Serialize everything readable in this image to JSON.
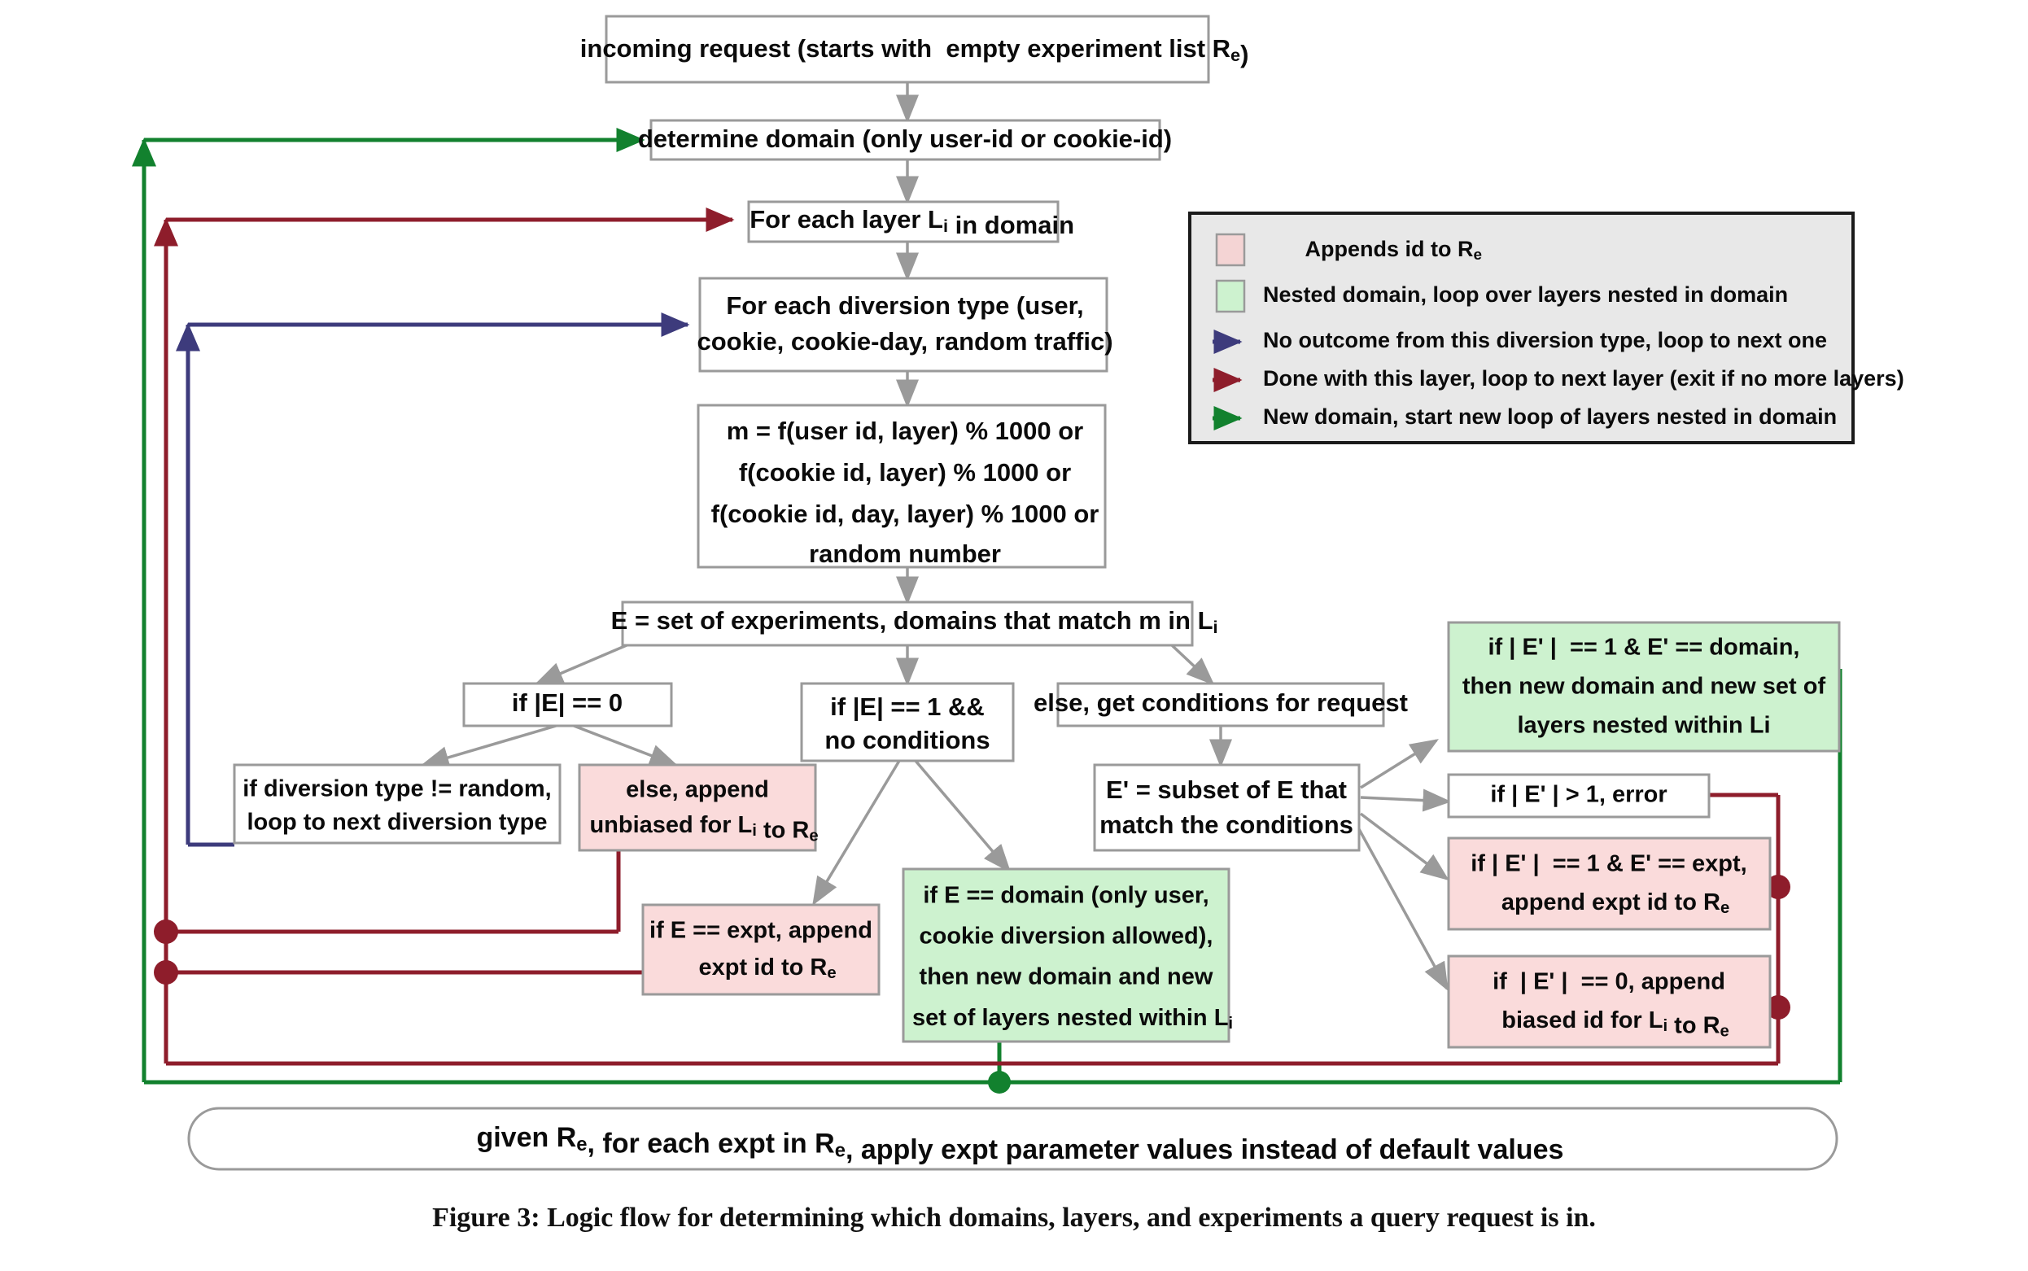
{
  "figure": {
    "caption": "Figure 3: Logic flow for determining which domains, layers, and experiments a query request is in."
  },
  "nodes": {
    "incoming_request": "incoming request (starts with  empty experiment list Re)",
    "incoming_request_l1": "incoming request (starts with  empty experiment list R",
    "incoming_request_sub": "e",
    "incoming_request_l1b": ")",
    "determine_domain": "determine domain (only user-id or cookie-id)",
    "for_each_layer_a": "For each layer L",
    "for_each_layer_sub": "i",
    "for_each_layer_b": " in domain",
    "diversion_type_l1": "For each diversion type (user,",
    "diversion_type_l2": "cookie, cookie-day, random traffic)",
    "formula_l1": "m = f(user id, layer) % 1000 or",
    "formula_l2": "f(cookie id, layer) % 1000 or",
    "formula_l3": "f(cookie id, day, layer) % 1000 or",
    "formula_l4": "random number",
    "e_set_a": "E = set of experiments, domains that match m in L",
    "e_set_sub": "i",
    "if_e_zero": "if |E| == 0",
    "if_e_one_l1": "if |E| == 1 &&",
    "if_e_one_l2": "no conditions",
    "else_conditions": "else, get conditions for request",
    "diversion_not_random_l1": "if diversion type != random,",
    "diversion_not_random_l2": "loop to next diversion type",
    "append_unbiased_l1": "else, append",
    "append_unbiased_l2a": "unbiased for L",
    "append_unbiased_sub1": "i",
    "append_unbiased_l2b": " to R",
    "append_unbiased_sub2": "e",
    "e_expt_l1": "if E == expt, append",
    "e_expt_l2a": "expt id to R",
    "e_expt_sub": "e",
    "e_domain_l1": "if E == domain (only user,",
    "e_domain_l2": "cookie diversion allowed),",
    "e_domain_l3": "then new domain and new",
    "e_domain_l4a": "set of layers nested within L",
    "e_domain_sub": "i",
    "eprime_subset_l1": "E' = subset of E that",
    "eprime_subset_l2": "match the conditions",
    "eprime_domain_l1": "if | E' |  == 1 & E' == domain,",
    "eprime_domain_l2": "then new domain and new set of",
    "eprime_domain_l3": "layers nested within Li",
    "eprime_error": "if | E' | > 1, error",
    "eprime_expt_l1": "if | E' |  == 1 & E' == expt,",
    "eprime_expt_l2a": "append expt id to R",
    "eprime_expt_sub": "e",
    "eprime_zero_l1": "if  | E' |  == 0, append",
    "eprime_zero_l2a": "biased id for L",
    "eprime_zero_sub1": "i",
    "eprime_zero_l2b": " to R",
    "eprime_zero_sub2": "e",
    "final_a": "given R",
    "final_sub1": "e",
    "final_b": ", for each expt in R",
    "final_sub2": "e",
    "final_c": ", apply expt parameter values instead of default values"
  },
  "legend": {
    "items": [
      {
        "kind": "swatch",
        "color": "#f4d4d4",
        "label_a": "Appends id to R",
        "label_sub": "e",
        "label_b": ""
      },
      {
        "kind": "swatch",
        "color": "#cdf2cf",
        "label_a": "Nested domain, loop over layers nested in domain",
        "label_sub": "",
        "label_b": ""
      },
      {
        "kind": "arrow",
        "color": "#3d3b7c",
        "label_a": "No outcome from this diversion type, loop to next one",
        "label_sub": "",
        "label_b": ""
      },
      {
        "kind": "arrow",
        "color": "#8e1d2b",
        "label_a": "Done with this layer, loop to next layer (exit if no more layers)",
        "label_sub": "",
        "label_b": ""
      },
      {
        "kind": "arrow",
        "color": "#12812e",
        "label_a": "New domain, start new loop of layers nested in domain",
        "label_sub": "",
        "label_b": ""
      }
    ]
  },
  "colors": {
    "pink_fill": "#fadbdb",
    "green_fill": "#cdf2cf",
    "box_stroke": "#9a9a9a",
    "red_line": "#8e1d2b",
    "green_line": "#12812e",
    "blue_line": "#3d3b7c",
    "legend_fill": "#e8e8e8"
  }
}
